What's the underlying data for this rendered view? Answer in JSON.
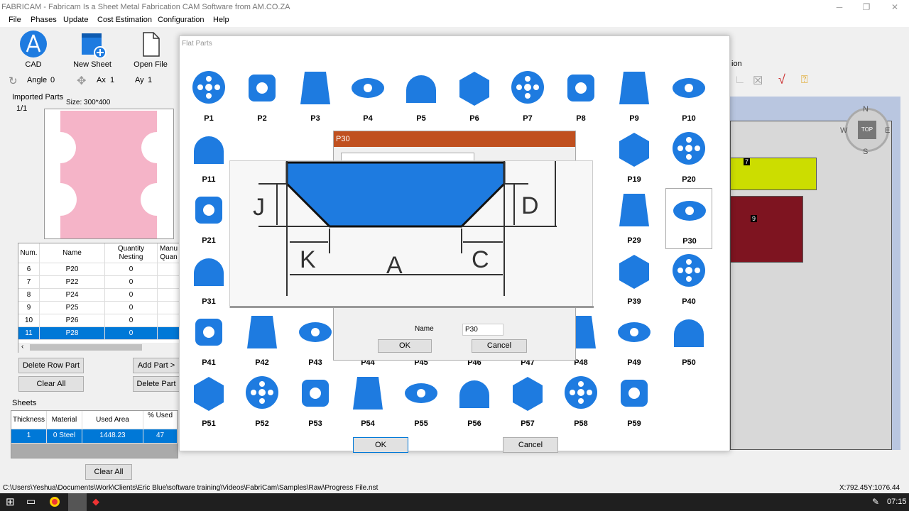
{
  "window": {
    "title": "FABRICAM - Fabricam Is a Sheet Metal Fabrication CAM Software from AM.CO.ZA"
  },
  "menu": [
    "File",
    "Phases",
    "Update",
    "Cost Estimation",
    "Configuration",
    "Help"
  ],
  "ribbon": {
    "cad": "CAD",
    "new_sheet": "New Sheet",
    "open_file": "Open File"
  },
  "toolrow": {
    "angle_label": "Angle",
    "angle_value": "0",
    "ax_label": "Ax",
    "ax_value": "1",
    "ay_label": "Ay",
    "ay_value": "1"
  },
  "imported": {
    "title": "Imported Parts",
    "count": "1/1",
    "size": "Size: 300*400"
  },
  "parts_table": {
    "headers": [
      "Num.",
      "Name",
      "Quantity Nesting",
      "Manu Quan"
    ],
    "rows": [
      [
        "6",
        "P20",
        "0"
      ],
      [
        "7",
        "P22",
        "0"
      ],
      [
        "8",
        "P24",
        "0"
      ],
      [
        "9",
        "P25",
        "0"
      ],
      [
        "10",
        "P26",
        "0"
      ],
      [
        "11",
        "P28",
        "0"
      ]
    ]
  },
  "left_buttons": {
    "delete_row": "Delete Row Part",
    "add_part": "Add Part >",
    "clear_all": "Clear All",
    "delete_part": "Delete Part"
  },
  "sheets": {
    "title": "Sheets",
    "headers": [
      "Thickness",
      "Material",
      "Used Area",
      "% Used"
    ],
    "row": [
      "1",
      "0 Steel",
      "1448.23",
      "47"
    ],
    "clear_all": "Clear All"
  },
  "status": {
    "path": "C:\\Users\\Yeshua\\Documents\\Work\\Clients\\Eric Blue\\software training\\Videos\\FabriCam\\Samples\\Raw\\Progress File.nst",
    "coords": "X:792.45Y:1076.44"
  },
  "taskbar": {
    "time": "07:15"
  },
  "flat_dialog": {
    "title": "Flat Parts",
    "ok": "OK",
    "cancel": "Cancel",
    "parts": [
      "P1",
      "P2",
      "P3",
      "P4",
      "P5",
      "P6",
      "P7",
      "P8",
      "P9",
      "P10",
      "P11",
      "P19",
      "P20",
      "P21",
      "P29",
      "P30",
      "P31",
      "P39",
      "P40",
      "P41",
      "P42",
      "P43",
      "P44",
      "P45",
      "P46",
      "P47",
      "P48",
      "P49",
      "P50",
      "P51",
      "P52",
      "P53",
      "P54",
      "P55",
      "P56",
      "P57",
      "P58",
      "P59"
    ]
  },
  "p30_dialog": {
    "title": "P30",
    "name_label": "Name",
    "name_value": "P30",
    "ok": "OK",
    "cancel": "Cancel",
    "dims": {
      "j": "J",
      "d": "D",
      "k": "K",
      "a": "A",
      "c": "C"
    }
  },
  "right": {
    "action_text": "ion",
    "compass": {
      "n": "N",
      "s": "S",
      "w": "W",
      "e": "E",
      "top": "TOP"
    },
    "tag7": "7",
    "tag9": "9"
  },
  "colors": {
    "part_blue": "#1e7be0",
    "accent_select": "#0078d7",
    "p30_title": "#c0501f",
    "pink": "#f5b4c8",
    "yellow": "#ccdd00",
    "maroon": "#7e1420"
  }
}
